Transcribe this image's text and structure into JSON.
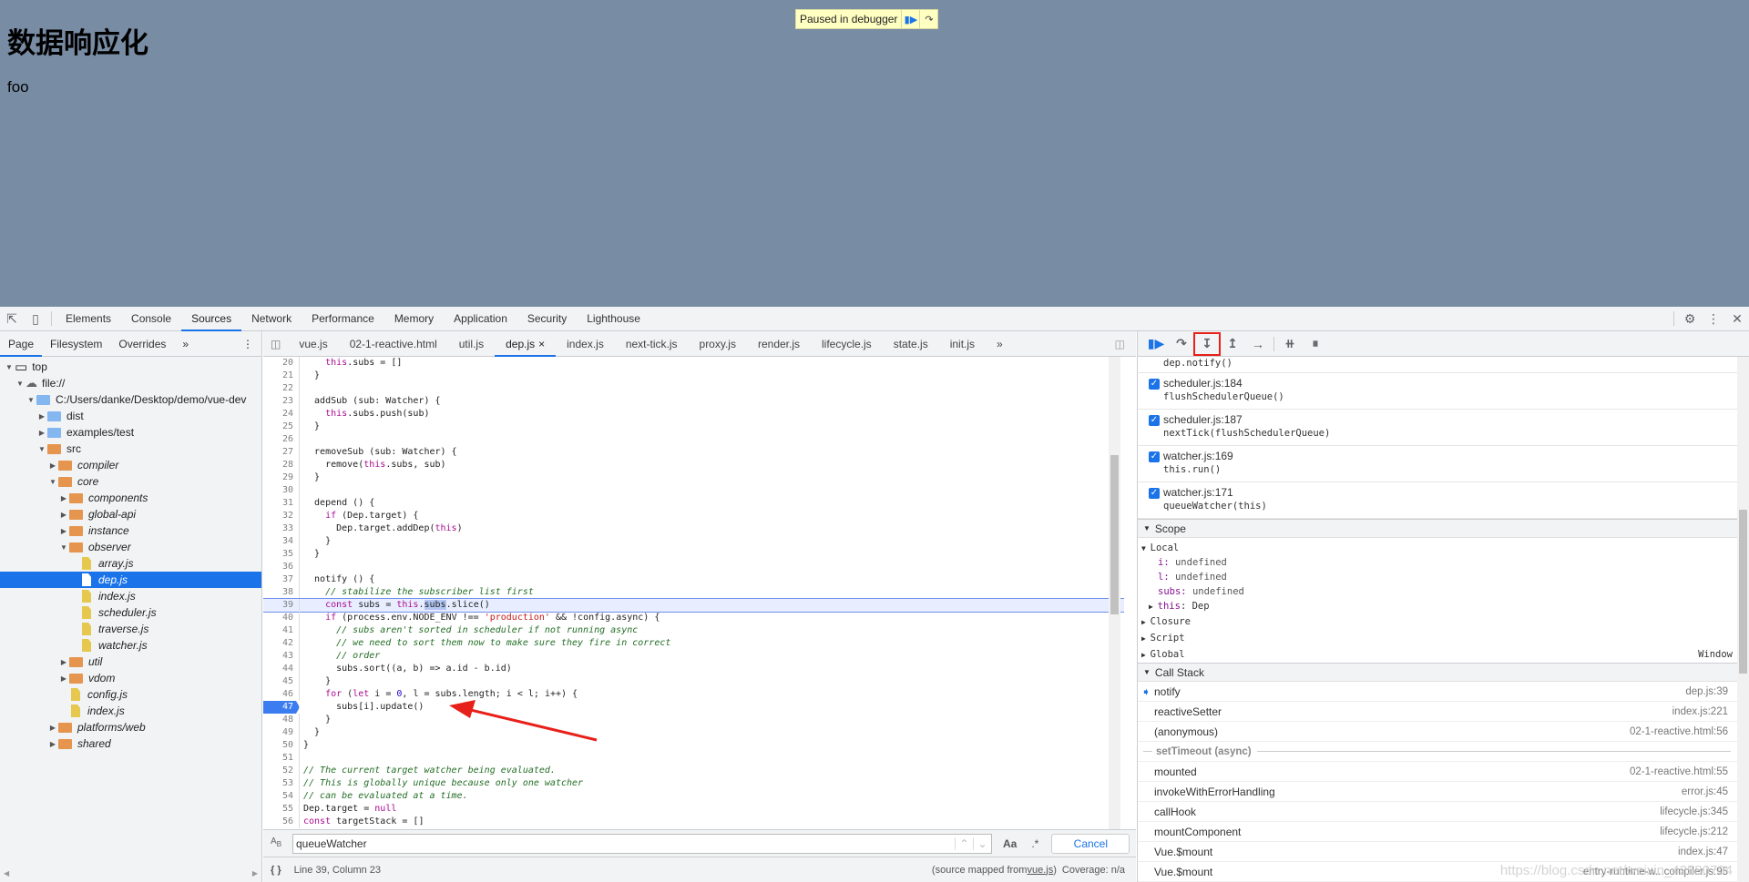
{
  "page": {
    "heading": "数据响应化",
    "text": "foo",
    "paused_label": "Paused in debugger"
  },
  "devtools": {
    "main_tabs": [
      "Elements",
      "Console",
      "Sources",
      "Network",
      "Performance",
      "Memory",
      "Application",
      "Security",
      "Lighthouse"
    ],
    "active_main_tab": "Sources",
    "nav_tabs": [
      "Page",
      "Filesystem",
      "Overrides"
    ],
    "more": "»",
    "tree": [
      {
        "label": "top",
        "depth": 0,
        "type": "frame",
        "open": true
      },
      {
        "label": "file://",
        "depth": 1,
        "type": "cloud",
        "open": true
      },
      {
        "label": "C:/Users/danke/Desktop/demo/vue-dev",
        "depth": 2,
        "type": "folder-blue",
        "open": true
      },
      {
        "label": "dist",
        "depth": 3,
        "type": "folder-blue",
        "open": false
      },
      {
        "label": "examples/test",
        "depth": 3,
        "type": "folder-blue",
        "open": false
      },
      {
        "label": "src",
        "depth": 3,
        "type": "folder-orange",
        "open": true
      },
      {
        "label": "compiler",
        "depth": 4,
        "type": "folder-orange",
        "open": false
      },
      {
        "label": "core",
        "depth": 4,
        "type": "folder-orange",
        "open": true
      },
      {
        "label": "components",
        "depth": 5,
        "type": "folder-orange",
        "open": false
      },
      {
        "label": "global-api",
        "depth": 5,
        "type": "folder-orange",
        "open": false
      },
      {
        "label": "instance",
        "depth": 5,
        "type": "folder-orange",
        "open": false
      },
      {
        "label": "observer",
        "depth": 5,
        "type": "folder-orange",
        "open": true
      },
      {
        "label": "array.js",
        "depth": 6,
        "type": "file"
      },
      {
        "label": "dep.js",
        "depth": 6,
        "type": "file",
        "selected": true
      },
      {
        "label": "index.js",
        "depth": 6,
        "type": "file"
      },
      {
        "label": "scheduler.js",
        "depth": 6,
        "type": "file"
      },
      {
        "label": "traverse.js",
        "depth": 6,
        "type": "file"
      },
      {
        "label": "watcher.js",
        "depth": 6,
        "type": "file"
      },
      {
        "label": "util",
        "depth": 5,
        "type": "folder-orange",
        "open": false
      },
      {
        "label": "vdom",
        "depth": 5,
        "type": "folder-orange",
        "open": false
      },
      {
        "label": "config.js",
        "depth": 5,
        "type": "file"
      },
      {
        "label": "index.js",
        "depth": 5,
        "type": "file"
      },
      {
        "label": "platforms/web",
        "depth": 4,
        "type": "folder-orange",
        "open": false
      },
      {
        "label": "shared",
        "depth": 4,
        "type": "folder-orange",
        "open": false
      }
    ],
    "editor_tabs": [
      "vue.js",
      "02-1-reactive.html",
      "util.js",
      "dep.js",
      "index.js",
      "next-tick.js",
      "proxy.js",
      "render.js",
      "lifecycle.js",
      "state.js",
      "init.js"
    ],
    "active_editor_tab": "dep.js",
    "close_glyph": "×",
    "code_start_line": 20,
    "current_line": 39,
    "breakpoint_line": 47,
    "code": [
      "    this.subs = []",
      "  }",
      "",
      "  addSub (sub: Watcher) {",
      "    this.subs.push(sub)",
      "  }",
      "",
      "  removeSub (sub: Watcher) {",
      "    remove(this.subs, sub)",
      "  }",
      "",
      "  depend () {",
      "    if (Dep.target) {",
      "      Dep.target.addDep(this)",
      "    }",
      "  }",
      "",
      "  notify () {",
      "    // stabilize the subscriber list first",
      "    const subs = this.subs.slice()",
      "    if (process.env.NODE_ENV !== 'production' && !config.async) {",
      "      // subs aren't sorted in scheduler if not running async",
      "      // we need to sort them now to make sure they fire in correct",
      "      // order",
      "      subs.sort((a, b) => a.id - b.id)",
      "    }",
      "    for (let i = 0, l = subs.length; i < l; i++) {",
      "      subs[i].update()",
      "    }",
      "  }",
      "}",
      "",
      "// The current target watcher being evaluated.",
      "// This is globally unique because only one watcher",
      "// can be evaluated at a time.",
      "Dep.target = null",
      "const targetStack = []"
    ],
    "search": {
      "value": "queueWatcher",
      "case_label": "Aa",
      "regex_label": ".*",
      "cancel": "Cancel"
    },
    "status": {
      "position": "Line 39, Column 23",
      "mapped_prefix": "(source mapped from ",
      "mapped_file": "vue.js",
      "mapped_suffix": ")",
      "coverage": "Coverage: n/a"
    },
    "breakpoints": [
      {
        "code": "dep.notify()",
        "partial": true
      },
      {
        "file": "scheduler.js:184",
        "code": "flushSchedulerQueue()",
        "checked": true
      },
      {
        "file": "scheduler.js:187",
        "code": "nextTick(flushSchedulerQueue)",
        "checked": true
      },
      {
        "file": "watcher.js:169",
        "code": "this.run()",
        "checked": true
      },
      {
        "file": "watcher.js:171",
        "code": "queueWatcher(this)",
        "checked": true
      }
    ],
    "scope": {
      "title": "Scope",
      "local": "Local",
      "vars": [
        {
          "name": "i",
          "value": "undefined"
        },
        {
          "name": "l",
          "value": "undefined"
        },
        {
          "name": "subs",
          "value": "undefined"
        }
      ],
      "this_row": {
        "name": "this",
        "value": "Dep"
      },
      "groups": [
        "Closure",
        "Script",
        "Global"
      ],
      "global_value": "Window"
    },
    "call_stack": {
      "title": "Call Stack",
      "frames": [
        {
          "fn": "notify",
          "loc": "dep.js:39",
          "current": true
        },
        {
          "fn": "reactiveSetter",
          "loc": "index.js:221"
        },
        {
          "fn": "(anonymous)",
          "loc": "02-1-reactive.html:56"
        }
      ],
      "async_label": "setTimeout (async)",
      "async_frames": [
        {
          "fn": "mounted",
          "loc": "02-1-reactive.html:55"
        },
        {
          "fn": "invokeWithErrorHandling",
          "loc": "error.js:45"
        },
        {
          "fn": "callHook",
          "loc": "lifecycle.js:345"
        },
        {
          "fn": "mountComponent",
          "loc": "lifecycle.js:212"
        },
        {
          "fn": "Vue.$mount",
          "loc": "index.js:47"
        },
        {
          "fn": "Vue.$mount",
          "loc": "entry-runtime-w...compiler.js:95"
        }
      ]
    },
    "watermark": "https://blog.csdn.net/weixin_42580704"
  },
  "colors": {
    "page_bg": "#788ca4",
    "accent": "#1a73e8",
    "highlight_box": "#e8201a",
    "arrow": "#e8201a"
  }
}
